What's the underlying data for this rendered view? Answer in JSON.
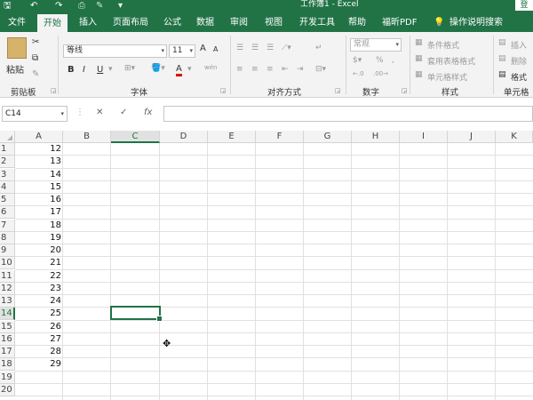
{
  "titlebar": {
    "title": "工作簿1 - Excel",
    "login": "登",
    "save_icon": "save-icon",
    "undo_icon": "undo-icon",
    "redo_icon": "redo-icon",
    "customize_icon": "customize-icon"
  },
  "tabs": [
    "文件",
    "开始",
    "插入",
    "页面布局",
    "公式",
    "数据",
    "审阅",
    "视图",
    "开发工具",
    "帮助",
    "福昕PDF",
    "操作说明搜索"
  ],
  "ribbon": {
    "clipboard": {
      "paste": "粘贴",
      "label": "剪贴板"
    },
    "font": {
      "name": "等线",
      "size": "11",
      "bold": "B",
      "italic": "I",
      "underline": "U",
      "grow": "A",
      "shrink": "A",
      "color": "A",
      "phonetic": "wén",
      "label": "字体"
    },
    "alignment": {
      "label": "对齐方式"
    },
    "number": {
      "format": "常规",
      "percent": "%",
      "comma": ",",
      "label": "数字"
    },
    "styles": {
      "conditional": "条件格式",
      "table": "套用表格格式",
      "cell": "单元格样式",
      "label": "样式"
    },
    "cells": {
      "insert": "插入",
      "delete": "删除",
      "format": "格式",
      "label": "单元格"
    }
  },
  "formula_bar": {
    "name_box": "C14",
    "cancel": "✕",
    "enter": "✓",
    "fx": "fx",
    "value": ""
  },
  "columns": [
    "A",
    "B",
    "C",
    "D",
    "E",
    "F",
    "G",
    "H",
    "I",
    "J",
    "K"
  ],
  "rows": [
    "1",
    "2",
    "3",
    "4",
    "5",
    "6",
    "7",
    "8",
    "9",
    "10",
    "11",
    "12",
    "13",
    "14",
    "15",
    "16",
    "17",
    "18",
    "19",
    "20"
  ],
  "column_a_values": [
    "12",
    "13",
    "14",
    "15",
    "16",
    "17",
    "18",
    "19",
    "20",
    "21",
    "22",
    "23",
    "24",
    "25",
    "26",
    "27",
    "28",
    "29"
  ],
  "active_cell": "C14",
  "accent": "#217346"
}
